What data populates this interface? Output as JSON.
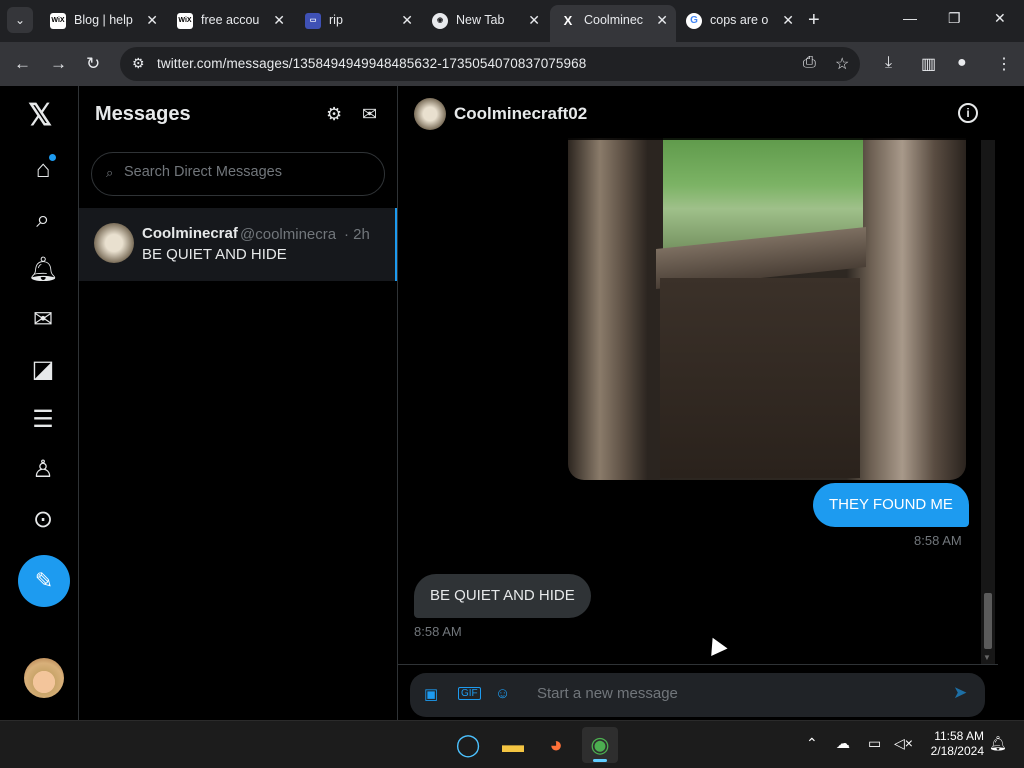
{
  "browser": {
    "tabs": [
      {
        "favicon": "wix-icon",
        "favicon_text": "WiX",
        "title": "Blog | help",
        "active": false
      },
      {
        "favicon": "wix-icon",
        "favicon_text": "WiX",
        "title": "free accou",
        "active": false
      },
      {
        "favicon": "rip-icon",
        "favicon_text": "",
        "title": "rip",
        "active": false
      },
      {
        "favicon": "chrome-icon",
        "favicon_text": "",
        "title": "New Tab",
        "active": false
      },
      {
        "favicon": "x-icon",
        "favicon_text": "X",
        "title": "Coolminec",
        "active": true
      },
      {
        "favicon": "google-icon",
        "favicon_text": "G",
        "title": "cops are o",
        "active": false
      }
    ],
    "url": "twitter.com/messages/1358494949948485632-1735054070837075968"
  },
  "messages_panel": {
    "title": "Messages",
    "search_placeholder": "Search Direct Messages",
    "conversations": [
      {
        "name": "Coolminecraf",
        "handle": "@coolminecra",
        "time": "· 2h",
        "preview": "BE QUIET AND HIDE"
      }
    ]
  },
  "chat": {
    "contact_name": "Coolminecraft02",
    "messages": [
      {
        "direction": "out",
        "text": "THEY FOUND ME",
        "time": "8:58 AM"
      },
      {
        "direction": "in",
        "text": "BE QUIET AND HIDE",
        "time": "8:58 AM"
      }
    ],
    "composer_placeholder": "Start a new message"
  },
  "taskbar": {
    "time": "11:58 AM",
    "date": "2/18/2024"
  },
  "colors": {
    "accent": "#1d9bf0",
    "background": "#000000",
    "incoming_bubble": "#2f3336"
  }
}
